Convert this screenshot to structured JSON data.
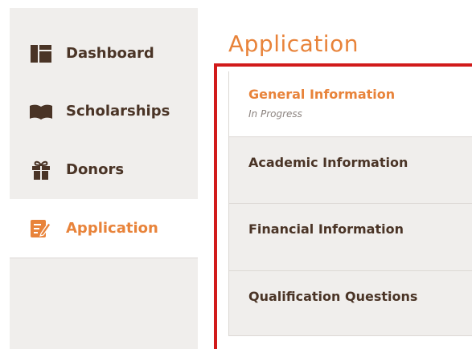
{
  "sidebar": {
    "items": [
      {
        "label": "Dashboard",
        "icon": "dashboard-icon"
      },
      {
        "label": "Scholarships",
        "icon": "book-icon"
      },
      {
        "label": "Donors",
        "icon": "gift-icon"
      },
      {
        "label": "Application",
        "icon": "edit-icon",
        "active": true
      }
    ]
  },
  "main": {
    "title": "Application",
    "steps": [
      {
        "label": "General Information",
        "status": "In Progress",
        "active": true
      },
      {
        "label": "Academic Information"
      },
      {
        "label": "Financial Information"
      },
      {
        "label": "Qualification Questions"
      }
    ]
  },
  "colors": {
    "accent": "#e8833a",
    "text_dark": "#4a3426",
    "sidebar_bg": "#f0eeec",
    "highlight_border": "#d11a1a"
  }
}
